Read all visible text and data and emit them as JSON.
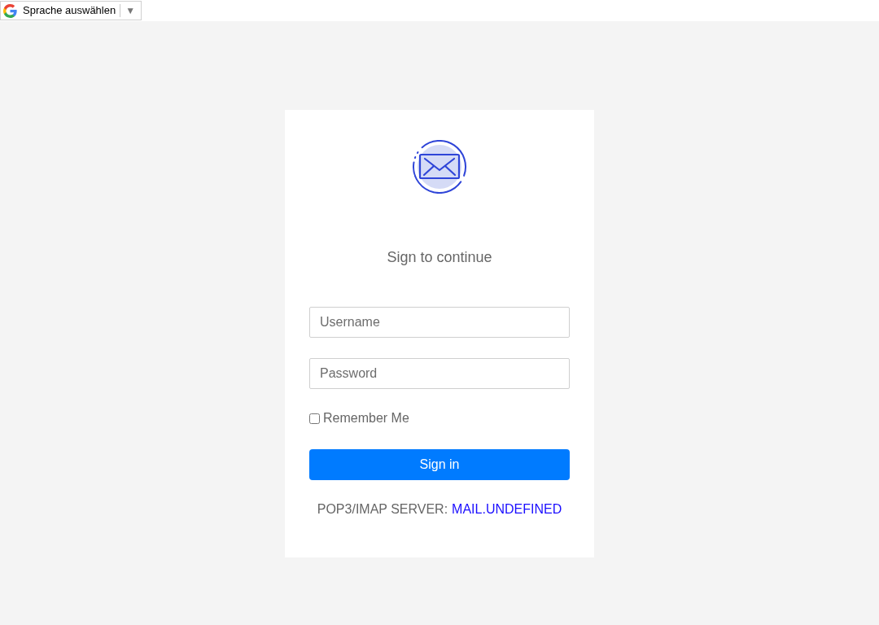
{
  "translate_widget": {
    "label": "Sprache auswählen",
    "arrow": "▼"
  },
  "login": {
    "title": "Sign to continue",
    "username": {
      "placeholder": "Username"
    },
    "password": {
      "placeholder": "Password"
    },
    "remember_me": {
      "label": "Remember Me",
      "checked": false
    },
    "sign_in_button": "Sign in",
    "server": {
      "label": "POP3/IMAP SERVER:",
      "value": "MAIL.UNDEFINED"
    }
  }
}
